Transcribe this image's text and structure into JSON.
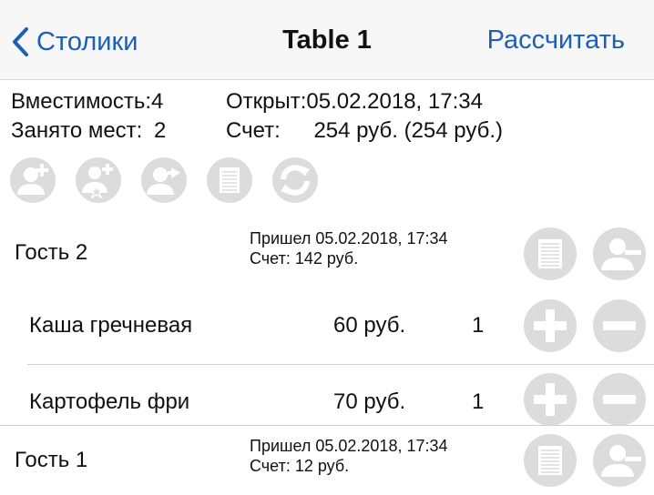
{
  "nav": {
    "back_label": "Столики",
    "title": "Table 1",
    "action_label": "Рассчитать"
  },
  "info": {
    "capacity_label": "Вместимость:",
    "capacity_value": "4",
    "occupied_label": "Занято мест:",
    "occupied_value": "2",
    "opened_label": "Открыт:",
    "opened_value": "05.02.2018, 17:34",
    "bill_label": "Счет:",
    "bill_value": "254 руб. (254 руб.)"
  },
  "toolbar_icons": [
    "add-guest-icon",
    "add-favorite-guest-icon",
    "move-guest-icon",
    "bill-icon",
    "refresh-icon"
  ],
  "guests": [
    {
      "name": "Гость 2",
      "arrived": "Пришел 05.02.2018, 17:34",
      "bill": "Счет: 142 руб.",
      "items": [
        {
          "name": "Каша гречневая",
          "price": "60 руб.",
          "qty": "1"
        },
        {
          "name": "Картофель фри",
          "price": "70 руб.",
          "qty": "1"
        }
      ]
    },
    {
      "name": "Гость 1",
      "arrived": "Пришел 05.02.2018, 17:34",
      "bill": "Счет: 12 руб.",
      "items": []
    }
  ],
  "colors": {
    "accent": "#1c5fb8",
    "icon_gray": "#dcdcdc",
    "navbar_bg": "#f7f7f7"
  }
}
